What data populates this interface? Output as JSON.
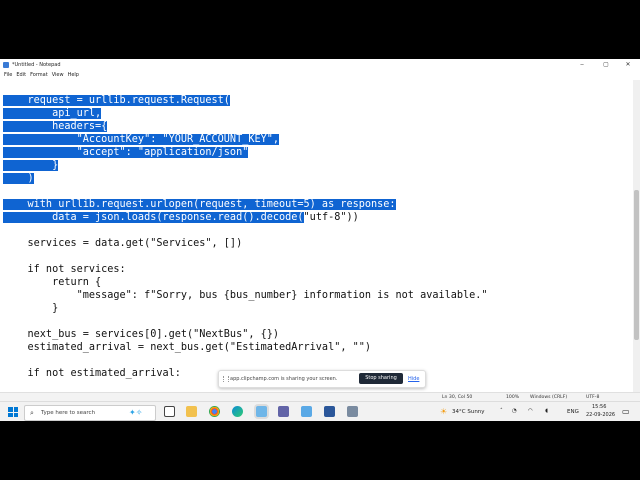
{
  "window": {
    "title": "*Untitled - Notepad",
    "controls": {
      "minimize": "‒",
      "maximize": "▢",
      "close": "✕"
    }
  },
  "menu": [
    "File",
    "Edit",
    "Format",
    "View",
    "Help"
  ],
  "editor": {
    "lines": [
      {
        "text": "    request = urllib.request.Request(",
        "selected": true
      },
      {
        "text": "        api_url,",
        "selected": true
      },
      {
        "text": "        headers={",
        "selected": true
      },
      {
        "text": "            \"AccountKey\": \"YOUR_ACCOUNT_KEY\",",
        "selected": true
      },
      {
        "text": "            \"accept\": \"application/json\"",
        "selected": true
      },
      {
        "text": "        }",
        "selected": true
      },
      {
        "text": "    )",
        "selected": true
      },
      {
        "text": "",
        "selected": false
      },
      {
        "text": "    with urllib.request.urlopen(request, timeout=5) as response:",
        "selected": true
      },
      {
        "text": "        data = json.loads(response.read().decode(",
        "selected": true,
        "rest": "\"utf-8\"))"
      },
      {
        "text": "",
        "selected": false
      },
      {
        "text": "    services = data.get(\"Services\", [])",
        "selected": false
      },
      {
        "text": "",
        "selected": false
      },
      {
        "text": "    if not services:",
        "selected": false
      },
      {
        "text": "        return {",
        "selected": false
      },
      {
        "text": "            \"message\": f\"Sorry, bus {bus_number} information is not available.\"",
        "selected": false
      },
      {
        "text": "        }",
        "selected": false
      },
      {
        "text": "",
        "selected": false
      },
      {
        "text": "    next_bus = services[0].get(\"NextBus\", {})",
        "selected": false
      },
      {
        "text": "    estimated_arrival = next_bus.get(\"EstimatedArrival\", \"\")",
        "selected": false
      },
      {
        "text": "",
        "selected": false
      },
      {
        "text": "    if not estimated_arrival:",
        "selected": false
      }
    ]
  },
  "status": {
    "position": "Ln 30, Col 50",
    "zoom": "100%",
    "line_ending": "Windows (CRLF)",
    "encoding": "UTF-8"
  },
  "share_bar": {
    "message": "app.clipchamp.com is sharing your screen.",
    "stop_label": "Stop sharing",
    "hide_label": "Hide"
  },
  "taskbar": {
    "search_placeholder": "Type here to search",
    "weather": "34°C  Sunny",
    "language": "ENG",
    "time": "15:56",
    "date": "22-09-2026"
  },
  "colors": {
    "selection": "#0f64d2",
    "accent": "#0078d4"
  }
}
